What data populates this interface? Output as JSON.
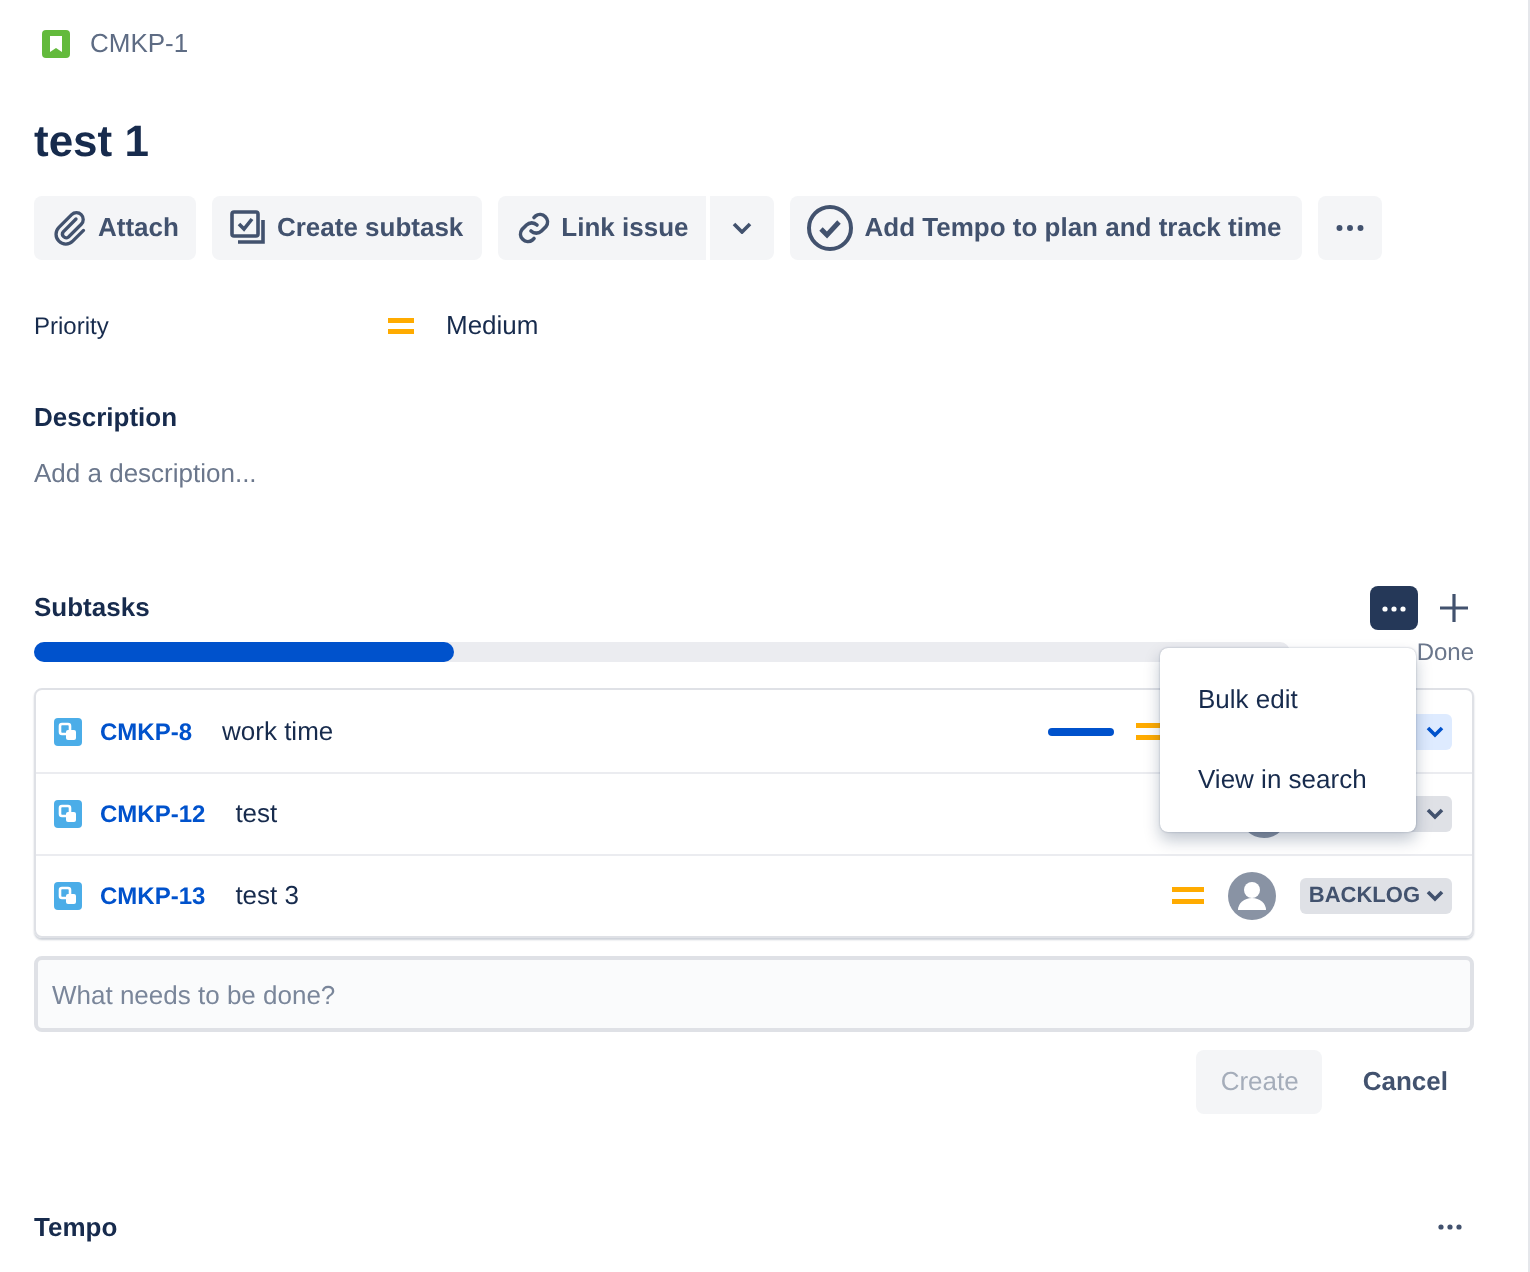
{
  "issue": {
    "key": "CMKP-1",
    "title": "test 1"
  },
  "toolbar": [
    {
      "kind": "attach",
      "label": "Attach"
    },
    {
      "kind": "subtask",
      "label": "Create subtask"
    },
    {
      "kind": "link",
      "label": "Link issue"
    },
    {
      "kind": "tempo",
      "label": "Add Tempo to plan and track time"
    },
    {
      "kind": "more"
    }
  ],
  "priority": {
    "label": "Priority",
    "value": "Medium"
  },
  "description": {
    "label": "Description",
    "placeholder": "Add a description..."
  },
  "subtasks": {
    "title": "Subtasks",
    "level": 0.335,
    "done_text": "Done",
    "rows": [
      {
        "key": "CMKP-8",
        "summary": "work time",
        "progress_line": true,
        "priority_visible": true,
        "avatar_visible": false,
        "status": {
          "color": "#deebff"
        }
      },
      {
        "key": "CMKP-12",
        "summary": "test",
        "progress_line": false,
        "priority_visible": false,
        "avatar_visible": true,
        "status": {
          "color": "#dfe1e6"
        }
      },
      {
        "key": "CMKP-13",
        "summary": "test 3",
        "progress_line": false,
        "priority_visible": true,
        "avatar_visible": true,
        "status": {
          "color": "#dfe1e6",
          "label": "BACKLOG"
        }
      }
    ],
    "new_placeholder": "What needs to be done?",
    "create": "Create",
    "cancel": "Cancel"
  },
  "menu": [
    {
      "label": "Bulk edit"
    },
    {
      "label": "View in search"
    }
  ],
  "tempo": {
    "title": "Tempo"
  }
}
